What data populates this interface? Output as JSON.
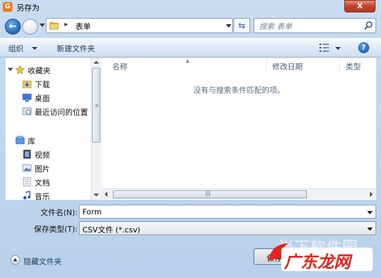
{
  "window": {
    "title": "另存为",
    "close_label": "X"
  },
  "address": {
    "breadcrumb_sep": "▸",
    "path": "表单"
  },
  "search": {
    "placeholder": "搜索 表单"
  },
  "toolbar": {
    "organize_label": "组织",
    "new_folder_label": "新建文件夹",
    "help_label": "?"
  },
  "sidebar": {
    "favorites_label": "收藏夹",
    "favorites": [
      {
        "label": "下载"
      },
      {
        "label": "桌面"
      },
      {
        "label": "最近访问的位置"
      }
    ],
    "library_label": "库",
    "library": [
      {
        "label": "视频"
      },
      {
        "label": "图片"
      },
      {
        "label": "文档"
      },
      {
        "label": "音乐"
      }
    ]
  },
  "filelist": {
    "columns": [
      "名称",
      "修改日期",
      "类型"
    ],
    "empty_message": "没有与搜索条件匹配的项。"
  },
  "form": {
    "filename_label": "文件名(N):",
    "filename_value": "Form",
    "filetype_label": "保存类型(T):",
    "filetype_value": "CSV文件 (*.csv)"
  },
  "footer": {
    "hide_folders_label": "隐藏文件夹",
    "save_label": "保存(S)"
  },
  "watermark": {
    "text": "当下软件园",
    "brand": "广东龙网"
  },
  "colors": {
    "accent": "#1e5bb1",
    "window_bg": "#c9dcf0",
    "brand_red": "#e2231a"
  }
}
